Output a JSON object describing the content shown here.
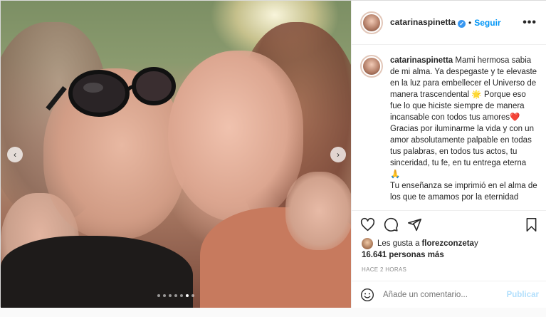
{
  "post": {
    "username": "catarinaspinetta",
    "follow_label": "Seguir",
    "separator": "•",
    "more_label": "•••",
    "caption_lines": [
      "Mami hermosa sabia de mi alma. Ya despegaste y te elevaste en la luz para embellecer el Universo de manera trascendental 🌟 Porque eso fue lo que hiciste siempre de manera incansable con todos tus amores❤️",
      "Gracias por iluminarme la vida y con un amor absolutamente palpable en todas tus palabras, en todos tus actos, tu sinceridad, tu fe, en tu entrega eterna 🙏",
      "Tu enseñanza se imprimió en el alma de los que te amamos por la eternidad"
    ],
    "likes": {
      "prefix": "Les gusta a ",
      "user": "florezconzeta",
      "suffix": " y",
      "count_text": "16.641 personas más"
    },
    "timestamp": "Hace 2 horas",
    "comment_placeholder": "Añade un comentario...",
    "publish_label": "Publicar"
  },
  "carousel": {
    "prev_label": "‹",
    "next_label": "›",
    "dot_count": 7,
    "active_dot": 5
  },
  "icons": [
    "heart-icon",
    "comment-icon",
    "share-icon",
    "bookmark-icon",
    "emoji-icon",
    "verified-badge-icon",
    "chevron-left-icon",
    "chevron-right-icon"
  ],
  "colors": {
    "link_blue": "#0095f6",
    "verified_blue": "#3897f0",
    "publish_disabled": "#b2dffc",
    "muted": "#8e8e8e"
  }
}
